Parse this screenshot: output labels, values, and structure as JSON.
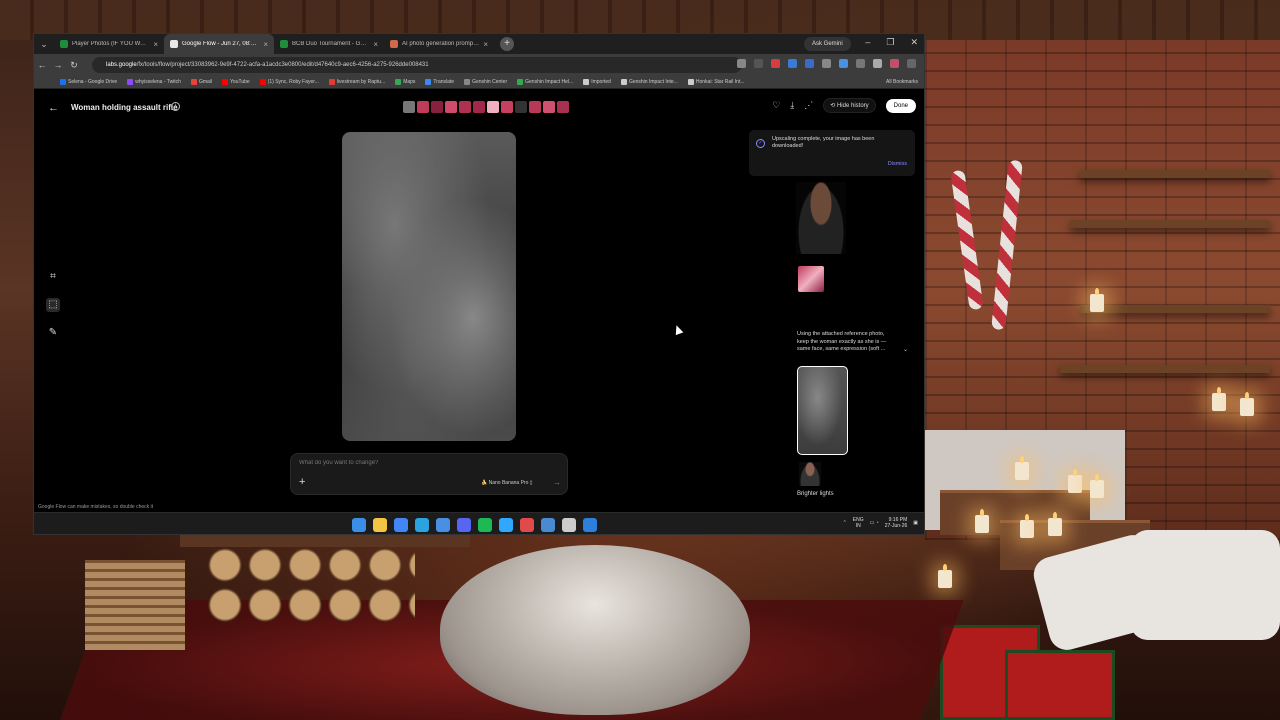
{
  "browser": {
    "tabs": [
      {
        "title": "Player Photos (IF YOU WANT !!",
        "favicon_color": "#1e8e3e",
        "active": false
      },
      {
        "title": "Google Flow - Jun 27, 08:10 PM",
        "favicon_color": "#e8e8e8",
        "active": true
      },
      {
        "title": "BCB Duo Tournament - Google",
        "favicon_color": "#1e8e3e",
        "active": false
      },
      {
        "title": "AI photo generation prompt fo",
        "favicon_color": "#d0694a",
        "active": false
      }
    ],
    "ask_gemini": "Ask Gemini",
    "url_host": "labs.google",
    "url_path": "/fx/tools/flow/project/33083962-9e9f-4722-acfa-a1acdc3e0800/edit/d47640c9-aec6-4256-a275-926dde008431",
    "bookmarks": [
      {
        "label": "Selena - Google Drive",
        "color": "#1a73e8"
      },
      {
        "label": "whyisselena - Twitch",
        "color": "#9146ff"
      },
      {
        "label": "Gmail",
        "color": "#ea4335"
      },
      {
        "label": "YouTube",
        "color": "#ff0000"
      },
      {
        "label": "(1) Sync, Roby Fayer...",
        "color": "#ff0000"
      },
      {
        "label": "livestream by Raptu...",
        "color": "#e53935"
      },
      {
        "label": "Maps",
        "color": "#34a853"
      },
      {
        "label": "Translate",
        "color": "#4285f4"
      },
      {
        "label": "Genshin Center",
        "color": "#888888"
      },
      {
        "label": "Genshin Impact Hel...",
        "color": "#34a853"
      },
      {
        "label": "Imported",
        "color": "#cccccc"
      },
      {
        "label": "Genshin Impact Inte...",
        "color": "#cccccc"
      },
      {
        "label": "Honkai: Star Rail Int...",
        "color": "#cccccc"
      }
    ],
    "all_bookmarks": "All Bookmarks"
  },
  "app": {
    "project_title": "Woman holding assault rifle",
    "hide_history": "Hide history",
    "done": "Done",
    "thumb_colors": [
      "#777777",
      "#c03a5a",
      "#8a2040",
      "#d04a6a",
      "#b03050",
      "#a02848",
      "#f0b0c0",
      "#c84060",
      "#333333",
      "#b83858",
      "#d05070",
      "#a83050"
    ],
    "prompt_placeholder": "What do you want to change?",
    "model_label": "Nano Banana Pro",
    "disclaimer": "Google Flow can make mistakes, so double check it"
  },
  "history": {
    "toast_message": "Upscaling complete, your image has been downloaded!",
    "dismiss": "Dismiss",
    "prompt_description": "Using the attached reference photo, keep the woman exactly as she is — same face, same expression (soft ...",
    "last_label": "Brighter lights"
  },
  "taskbar": {
    "app_colors": [
      "#3a8ee6",
      "#f4c542",
      "#4285f4",
      "#2aa3e0",
      "#4a90e2",
      "#5865f2",
      "#1db954",
      "#31a8ff",
      "#e04a4a",
      "#4a8ad0",
      "#cccccc",
      "#2e7fd9"
    ],
    "lang": "ENG",
    "region": "IN",
    "time": "9:16 PM",
    "date": "27-Jun-26"
  }
}
